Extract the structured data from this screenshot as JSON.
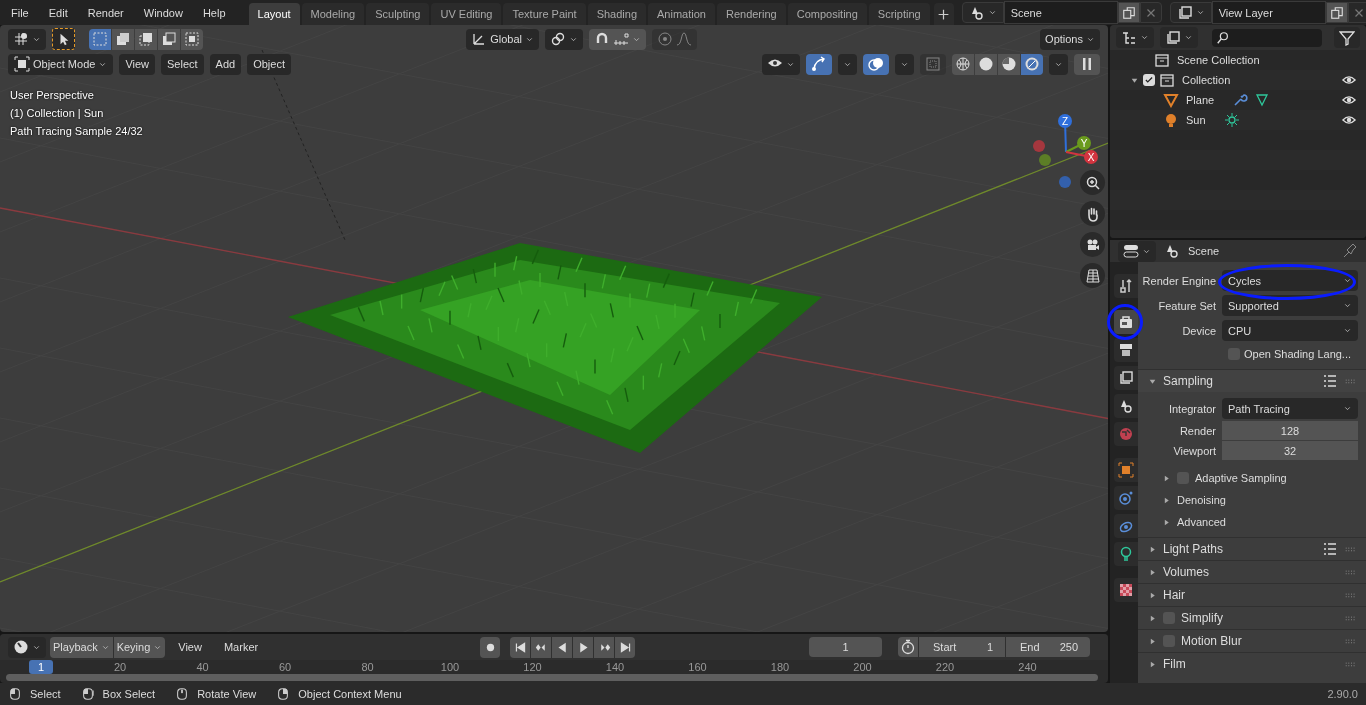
{
  "menu": [
    "File",
    "Edit",
    "Render",
    "Window",
    "Help"
  ],
  "workspaces": [
    {
      "label": "Layout",
      "selected": true
    },
    {
      "label": "Modeling",
      "selected": false
    },
    {
      "label": "Sculpting",
      "selected": false
    },
    {
      "label": "UV Editing",
      "selected": false
    },
    {
      "label": "Texture Paint",
      "selected": false
    },
    {
      "label": "Shading",
      "selected": false
    },
    {
      "label": "Animation",
      "selected": false
    },
    {
      "label": "Rendering",
      "selected": false
    },
    {
      "label": "Compositing",
      "selected": false
    },
    {
      "label": "Scripting",
      "selected": false
    }
  ],
  "scene": "Scene",
  "view_layer": "View Layer",
  "tool_header": {
    "select_modes": [
      {
        "selected": true
      },
      {
        "selected": false
      },
      {
        "selected": false
      },
      {
        "selected": false
      },
      {
        "selected": false
      }
    ],
    "orientation": "Global",
    "snap": false,
    "proportional": false,
    "options": "Options"
  },
  "viewport_header": {
    "mode": "Object Mode",
    "menus": [
      "View",
      "Select",
      "Add",
      "Object"
    ],
    "show_gizmos": true,
    "show_overlays": true,
    "xray": false,
    "shading": [
      {
        "kind": "wireframe",
        "selected": false
      },
      {
        "kind": "solid",
        "selected": false
      },
      {
        "kind": "material",
        "selected": false
      },
      {
        "kind": "rendered",
        "selected": true
      }
    ]
  },
  "viewport_info": [
    "User Perspective",
    "(1) Collection | Sun",
    "Path Tracing Sample 24/32"
  ],
  "gizmo_axes": [
    {
      "kind": "z",
      "label": "Z"
    },
    {
      "kind": "y",
      "label": "Y"
    },
    {
      "kind": "x",
      "label": "X"
    }
  ],
  "outliner": {
    "root": "Scene Collection",
    "children": [
      {
        "name": "Collection",
        "kind": "collection",
        "checked": true,
        "expanded": true,
        "visible": true,
        "children": [
          {
            "name": "Plane",
            "kind": "mesh",
            "visible": true
          },
          {
            "name": "Sun",
            "kind": "light",
            "visible": true
          }
        ]
      }
    ]
  },
  "properties": {
    "context": "Scene",
    "tab_groups": [
      [
        {
          "kind": "tool",
          "selected": false
        }
      ],
      [
        {
          "kind": "render",
          "selected": true
        },
        {
          "kind": "output",
          "selected": false
        },
        {
          "kind": "view-layer",
          "selected": false
        },
        {
          "kind": "scene",
          "selected": false
        },
        {
          "kind": "world",
          "selected": false
        }
      ],
      [
        {
          "kind": "object",
          "selected": false
        },
        {
          "kind": "physics",
          "selected": false
        },
        {
          "kind": "constraints",
          "selected": false
        },
        {
          "kind": "light",
          "selected": false
        }
      ],
      [
        {
          "kind": "texture",
          "selected": false
        }
      ]
    ],
    "fields": [
      {
        "kind": "dropdown",
        "label": "Render Engine",
        "value": "Cycles"
      },
      {
        "kind": "dropdown",
        "label": "Feature Set",
        "value": "Supported"
      },
      {
        "kind": "dropdown",
        "label": "Device",
        "value": "CPU"
      },
      {
        "kind": "checkbox",
        "label": "Open Shading Lang...",
        "checked": false
      }
    ],
    "panels": [
      {
        "title": "Sampling",
        "expanded": true,
        "presets": true,
        "fields": [
          {
            "kind": "dropdown",
            "label": "Integrator",
            "value": "Path Tracing"
          },
          {
            "kind": "number",
            "label": "Render",
            "value": "128"
          },
          {
            "kind": "number",
            "label": "Viewport",
            "value": "32"
          }
        ],
        "subpanels": [
          {
            "title": "Adaptive Sampling",
            "expanded": false,
            "checkbox": true,
            "checked": false
          },
          {
            "title": "Denoising",
            "expanded": false
          },
          {
            "title": "Advanced",
            "expanded": false
          }
        ]
      },
      {
        "title": "Light Paths",
        "expanded": false,
        "presets": true
      },
      {
        "title": "Volumes",
        "expanded": false
      },
      {
        "title": "Hair",
        "expanded": false
      },
      {
        "title": "Simplify",
        "expanded": false,
        "checkbox": true,
        "checked": false
      },
      {
        "title": "Motion Blur",
        "expanded": false,
        "checkbox": true,
        "checked": false
      },
      {
        "title": "Film",
        "expanded": false
      }
    ]
  },
  "timeline": {
    "menus": [
      {
        "kind": "dropdown",
        "label": "Playback"
      },
      {
        "kind": "dropdown",
        "label": "Keying"
      },
      {
        "kind": "menu",
        "label": "View"
      },
      {
        "kind": "menu",
        "label": "Marker"
      }
    ],
    "current_frame": "1",
    "start_label": "Start",
    "start": "1",
    "end_label": "End",
    "end": "250",
    "ruler": [
      "1",
      "20",
      "40",
      "60",
      "80",
      "100",
      "120",
      "140",
      "160",
      "180",
      "200",
      "220",
      "240"
    ]
  },
  "status_bar": {
    "hints": [
      {
        "kind": "left",
        "label": "Select"
      },
      {
        "kind": "drag",
        "label": "Box Select"
      },
      {
        "kind": "middle",
        "label": "Rotate View"
      },
      {
        "kind": "right",
        "label": "Object Context Menu"
      }
    ],
    "version": "2.90.0"
  }
}
